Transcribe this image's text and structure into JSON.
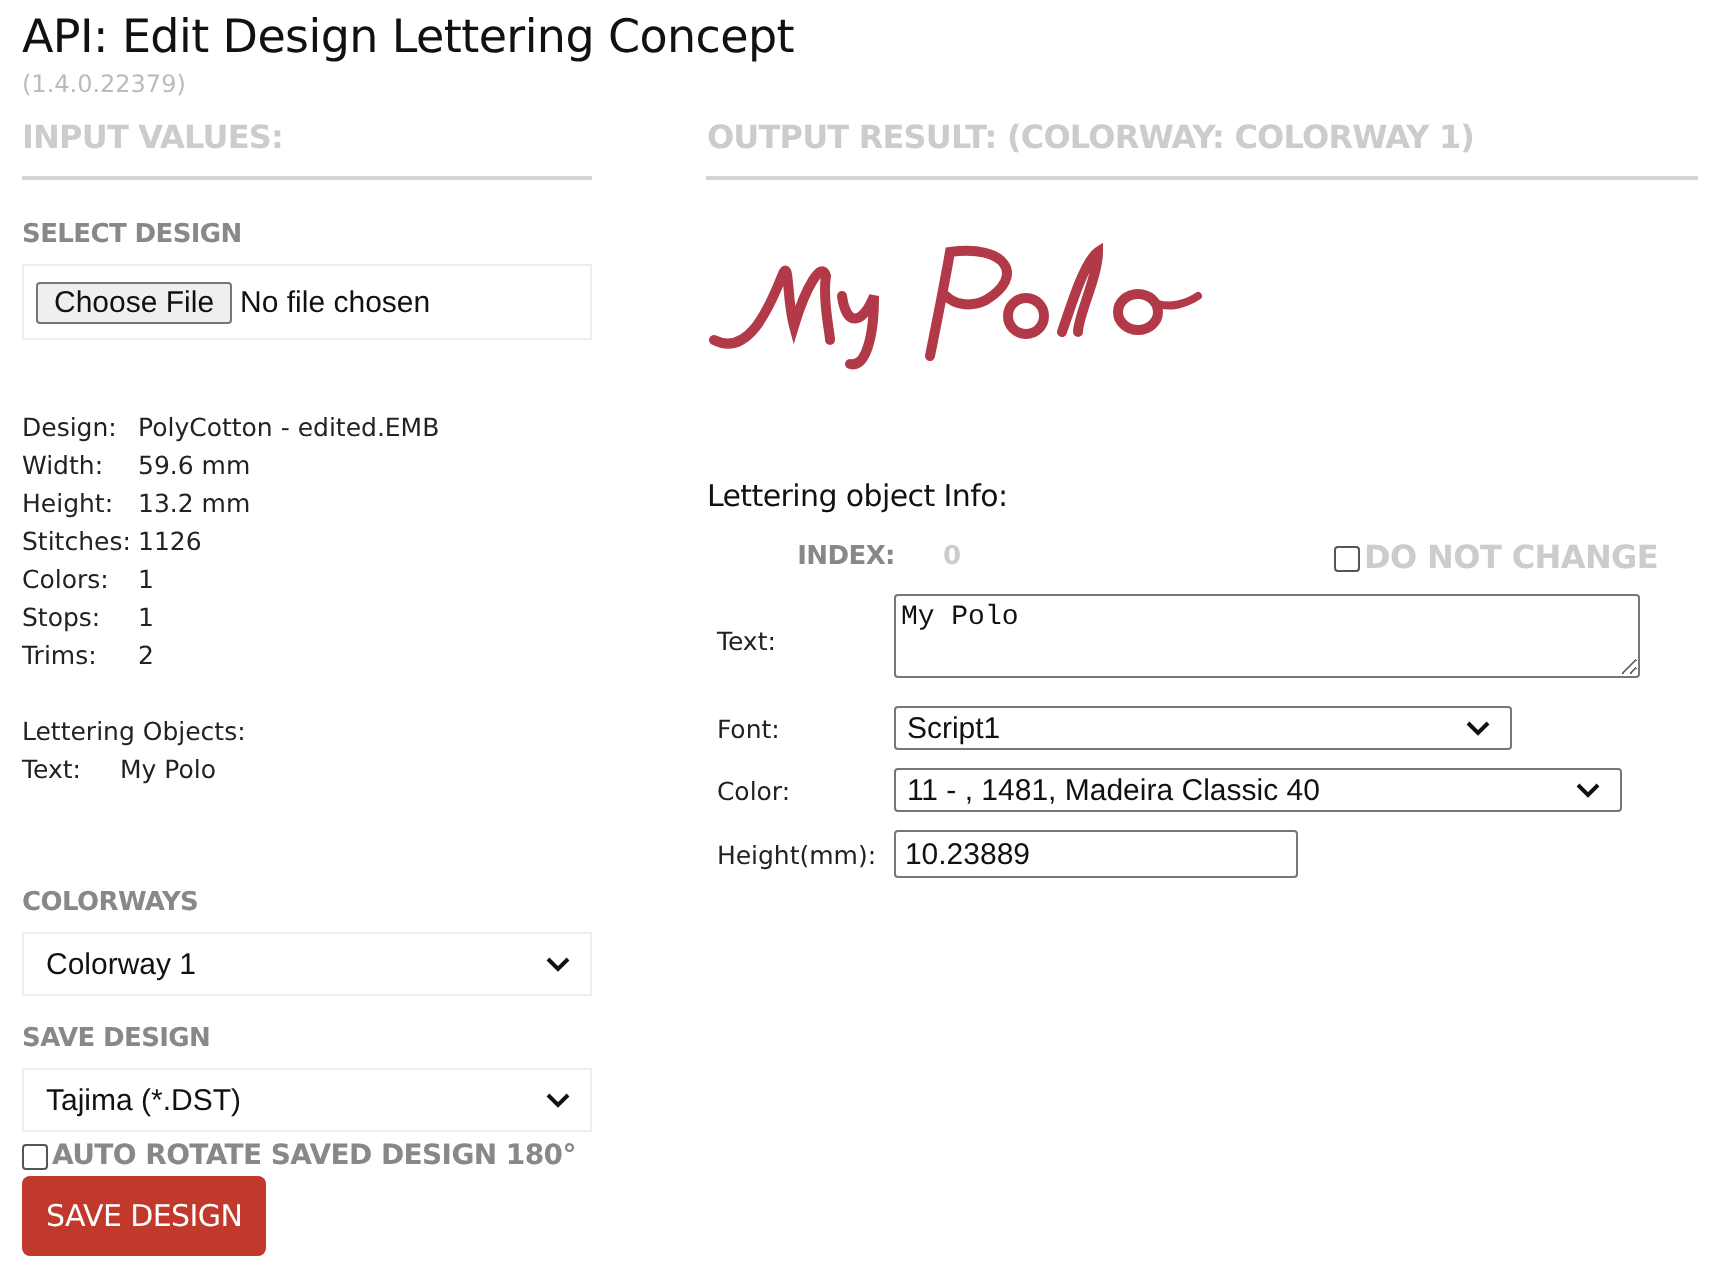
{
  "title": "API: Edit Design Lettering Concept",
  "version": "(1.4.0.22379)",
  "input": {
    "heading": "INPUT VALUES:",
    "select_design": {
      "label": "SELECT DESIGN",
      "button": "Choose File",
      "status": "No file chosen"
    },
    "design_info": [
      {
        "label": "Design:",
        "value": "PolyCotton - edited.EMB"
      },
      {
        "label": "Width:",
        "value": "59.6 mm"
      },
      {
        "label": "Height:",
        "value": "13.2 mm"
      },
      {
        "label": "Stitches:",
        "value": "1126"
      },
      {
        "label": "Colors:",
        "value": "1"
      },
      {
        "label": "Stops:",
        "value": "1"
      },
      {
        "label": "Trims:",
        "value": "2"
      }
    ],
    "lettering_objects": {
      "heading": "Lettering Objects:",
      "items": [
        {
          "label": "Text:",
          "value": "My Polo"
        }
      ]
    },
    "colorways": {
      "label": "COLORWAYS",
      "value": "Colorway 1"
    },
    "save_design": {
      "label": "SAVE DESIGN",
      "value": "Tajima (*.DST)"
    },
    "auto_rotate": {
      "label": "AUTO ROTATE SAVED DESIGN 180°",
      "checked": false
    },
    "save_button": "SAVE DESIGN"
  },
  "output": {
    "heading": "OUTPUT RESULT: (COLORWAY: COLORWAY 1)",
    "info_heading": "Lettering object Info:",
    "index": {
      "label": "INDEX:",
      "value": "0"
    },
    "do_not_change": {
      "label": "DO NOT CHANGE",
      "checked": false
    },
    "fields": [
      {
        "kind": "textarea",
        "label": "Text:",
        "value": "My Polo"
      },
      {
        "kind": "select",
        "label": "Font:",
        "value": "Script1"
      },
      {
        "kind": "select",
        "label": "Color:",
        "value": "11 - , 1481, Madeira Classic 40"
      },
      {
        "kind": "input",
        "label": "Height(mm):",
        "value": "10.23889"
      }
    ]
  }
}
